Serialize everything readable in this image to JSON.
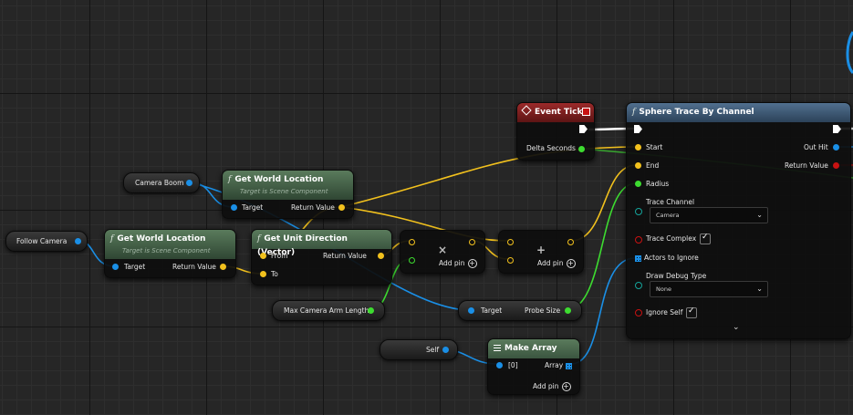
{
  "colors": {
    "object_wire": "#1a8fe6",
    "vector_wire": "#f2c11d",
    "float_wire": "#3ddc30",
    "exec_wire": "#ffffff",
    "function_header": "#4e6e51",
    "event_header": "#8c2424",
    "trace_header": "#3e5a78"
  },
  "event_tick": {
    "title": "Event Tick",
    "delta": "Delta Seconds"
  },
  "camera_boom": {
    "label": "Camera Boom"
  },
  "follow_camera": {
    "label": "Follow Camera"
  },
  "gwl1": {
    "title": "Get World Location",
    "subtitle": "Target is Scene Component",
    "target": "Target",
    "ret": "Return Value"
  },
  "gwl2": {
    "title": "Get World Location",
    "subtitle": "Target is Scene Component",
    "target": "Target",
    "ret": "Return Value"
  },
  "unit_dir": {
    "title": "Get Unit Direction (Vector)",
    "from": "From",
    "to": "To",
    "ret": "Return Value"
  },
  "multiply": {
    "symbol": "×",
    "add_pin": "Add pin"
  },
  "add": {
    "symbol": "+",
    "add_pin": "Add pin"
  },
  "max_arm": {
    "label": "Max Camera Arm Length"
  },
  "probe": {
    "target": "Target",
    "value": "Probe Size"
  },
  "self_node": {
    "label": "Self"
  },
  "make_array": {
    "title": "Make Array",
    "item0": "[0]",
    "array": "Array",
    "add_pin": "Add pin"
  },
  "sphere_trace": {
    "title": "Sphere Trace By Channel",
    "start": "Start",
    "end": "End",
    "radius": "Radius",
    "trace_channel": "Trace Channel",
    "trace_channel_value": "Camera",
    "trace_complex": "Trace Complex",
    "actors_to_ignore": "Actors to Ignore",
    "draw_debug_type": "Draw Debug Type",
    "draw_debug_value": "None",
    "ignore_self": "Ignore Self",
    "out_hit": "Out Hit",
    "return_value": "Return Value"
  }
}
